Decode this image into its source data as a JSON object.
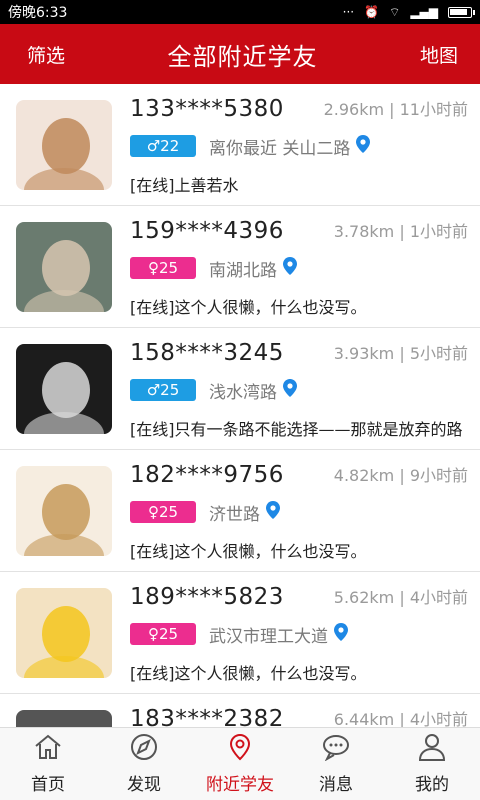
{
  "status_bar": {
    "time": "傍晚6:33",
    "battery_level": 0.9
  },
  "header": {
    "left": "筛选",
    "title": "全部附近学友",
    "right": "地图"
  },
  "users": [
    {
      "phone": "133****5380",
      "distance": "2.96km",
      "time_ago": "11小时前",
      "gender": "male",
      "age_label": "♂22",
      "location": "离你最近  关山二路",
      "bio": "[在线]上善若水",
      "avatar_colors": [
        "#f2e4da",
        "#c08a5b"
      ]
    },
    {
      "phone": "159****4396",
      "distance": "3.78km",
      "time_ago": "1小时前",
      "gender": "female",
      "age_label": "♀25",
      "location": "南湖北路",
      "bio": "[在线]这个人很懒，什么也没写。",
      "avatar_colors": [
        "#6a7b6f",
        "#d6c6b0"
      ]
    },
    {
      "phone": "158****3245",
      "distance": "3.93km",
      "time_ago": "5小时前",
      "gender": "male",
      "age_label": "♂25",
      "location": "浅水湾路",
      "bio": "[在线]只有一条路不能选择——那就是放弃的路",
      "avatar_colors": [
        "#1c1c1c",
        "#d8d8d8"
      ]
    },
    {
      "phone": "182****9756",
      "distance": "4.82km",
      "time_ago": "9小时前",
      "gender": "female",
      "age_label": "♀25",
      "location": "济世路",
      "bio": "[在线]这个人很懒，什么也没写。",
      "avatar_colors": [
        "#f6ede0",
        "#c79a5a"
      ]
    },
    {
      "phone": "189****5823",
      "distance": "5.62km",
      "time_ago": "4小时前",
      "gender": "female",
      "age_label": "♀25",
      "location": "武汉市理工大道",
      "bio": "[在线]这个人很懒，什么也没写。",
      "avatar_colors": [
        "#f3e2c2",
        "#f3c61d"
      ]
    },
    {
      "phone": "183****2382",
      "distance": "6.44km",
      "time_ago": "4小时前",
      "gender": "male",
      "age_label": "",
      "location": "",
      "bio": "",
      "avatar_colors": [
        "#555",
        "#888"
      ]
    }
  ],
  "tabs": [
    {
      "label": "首页",
      "icon": "home-icon",
      "active": false
    },
    {
      "label": "发现",
      "icon": "compass-icon",
      "active": false
    },
    {
      "label": "附近学友",
      "icon": "location-pin-icon",
      "active": true
    },
    {
      "label": "消息",
      "icon": "chat-bubble-icon",
      "active": false
    },
    {
      "label": "我的",
      "icon": "person-icon",
      "active": false
    }
  ],
  "colors": {
    "header_bg": "#c80a14",
    "male_badge": "#1e9de3",
    "female_badge": "#ec2d8f",
    "pin": "#1e88e5",
    "tab_active": "#d0121b"
  }
}
